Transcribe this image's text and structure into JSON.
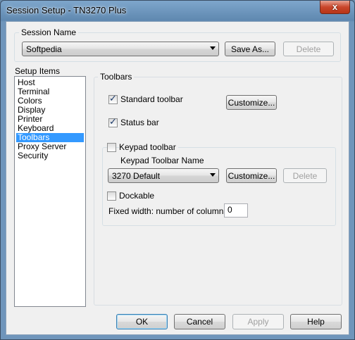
{
  "window": {
    "title": "Session Setup - TN3270 Plus",
    "close_glyph": "x"
  },
  "session": {
    "group_label": "Session Name",
    "name_value": "Softpedia",
    "save_as_label": "Save As...",
    "delete_label": "Delete"
  },
  "setup_items": {
    "label": "Setup Items",
    "items": [
      "Host",
      "Terminal",
      "Colors",
      "Display",
      "Printer",
      "Keyboard",
      "Toolbars",
      "Proxy Server",
      "Security"
    ],
    "selected": "Toolbars"
  },
  "toolbars": {
    "group_label": "Toolbars",
    "standard_toolbar": {
      "label": "Standard toolbar",
      "checked": true
    },
    "standard_customize_label": "Customize...",
    "status_bar": {
      "label": "Status bar",
      "checked": true
    },
    "keypad_toolbar": {
      "label": "Keypad toolbar",
      "checked": false
    },
    "keypad_name_label": "Keypad Toolbar Name",
    "keypad_name_value": "3270 Default",
    "keypad_customize_label": "Customize...",
    "keypad_delete_label": "Delete",
    "dockable": {
      "label": "Dockable",
      "checked": false
    },
    "fixed_width_label": "Fixed width: number of columns",
    "fixed_width_value": "0"
  },
  "buttons": {
    "ok": "OK",
    "cancel": "Cancel",
    "apply": "Apply",
    "help": "Help"
  }
}
